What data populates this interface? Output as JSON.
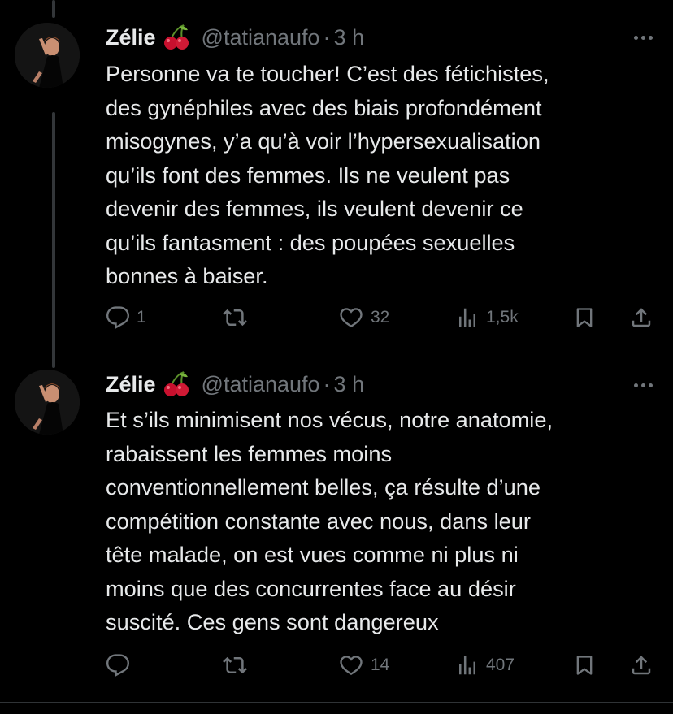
{
  "tweets": [
    {
      "author": "Zélie",
      "emoji": "cherries-icon",
      "handle": "@tatianaufo",
      "separator": "·",
      "time": "3 h",
      "text": "Personne va te toucher! C’est des fétichistes,\ndes gynéphiles avec des biais profondément\nmisogynes, y’a qu’à voir l’hypersexualisation\nqu’ils font des femmes. Ils ne veulent pas\ndevenir des femmes, ils veulent devenir ce\nqu’ils fantasment : des poupées sexuelles\nbonnes à baiser.",
      "replies": "1",
      "retweets": "",
      "likes": "32",
      "views": "1,5k"
    },
    {
      "author": "Zélie",
      "emoji": "cherries-icon",
      "handle": "@tatianaufo",
      "separator": "·",
      "time": "3 h",
      "text": "Et s’ils minimisent nos vécus, notre anatomie,\nrabaissent les femmes moins\nconventionnellement belles, ça résulte d’une\ncompétition constante avec nous, dans leur\ntête malade, on est vues comme ni plus ni\nmoins que des concurrentes face au désir\nsuscité. Ces gens sont dangereux",
      "replies": "",
      "retweets": "",
      "likes": "14",
      "views": "407"
    }
  ],
  "colors": {
    "background": "#000000",
    "text": "#e7e9ea",
    "muted": "#71767b",
    "thread": "#333639"
  }
}
